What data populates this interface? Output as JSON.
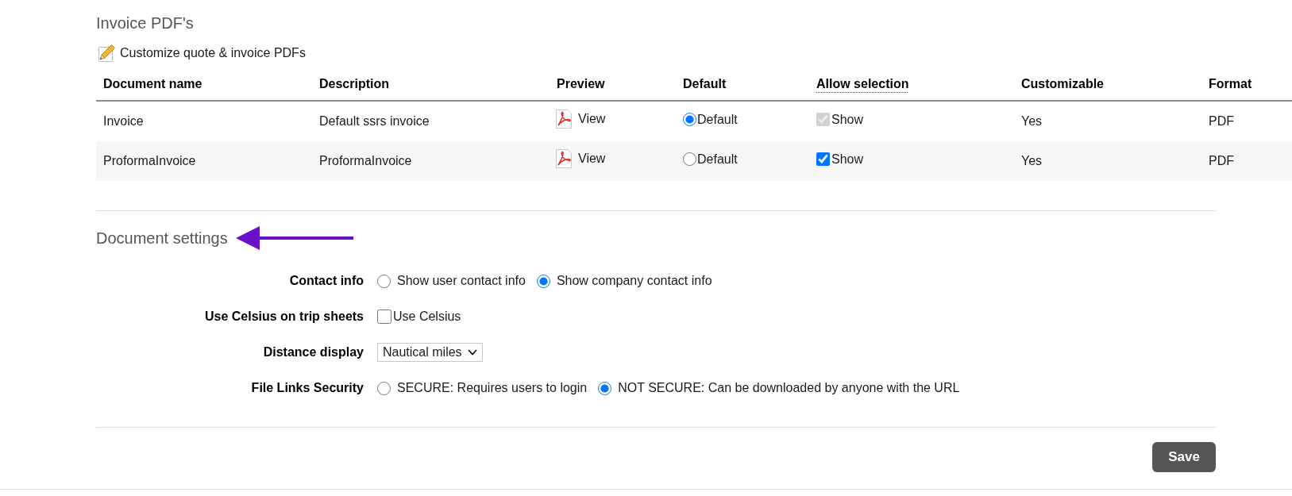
{
  "invoice_pdfs": {
    "title": "Invoice PDF's",
    "customize_link": "Customize quote & invoice PDFs",
    "table": {
      "columns": [
        {
          "label": "Document name",
          "tooltip": false
        },
        {
          "label": "Description",
          "tooltip": false
        },
        {
          "label": "Preview",
          "tooltip": false
        },
        {
          "label": "Default",
          "tooltip": false
        },
        {
          "label": "Allow selection",
          "tooltip": true
        },
        {
          "label": "Customizable",
          "tooltip": false
        },
        {
          "label": "Format",
          "tooltip": false
        }
      ],
      "rows": [
        {
          "document_name": "Invoice",
          "description": "Default ssrs invoice",
          "preview": "View",
          "default": {
            "label": "Default",
            "selected": true
          },
          "allow_selection": {
            "label": "Show",
            "checked": true,
            "disabled": true
          },
          "customizable": "Yes",
          "format": "PDF"
        },
        {
          "document_name": "ProformaInvoice",
          "description": "ProformaInvoice",
          "preview": "View",
          "default": {
            "label": "Default",
            "selected": false
          },
          "allow_selection": {
            "label": "Show",
            "checked": true,
            "disabled": false
          },
          "customizable": "Yes",
          "format": "PDF"
        }
      ]
    }
  },
  "document_settings": {
    "title": "Document settings",
    "settings": [
      {
        "kind": "radio",
        "label": "Contact info",
        "options": [
          {
            "label": "Show user contact info",
            "selected": false
          },
          {
            "label": "Show company contact info",
            "selected": true
          }
        ]
      },
      {
        "kind": "checkbox",
        "label": "Use Celsius on trip sheets",
        "option": {
          "label": "Use Celsius",
          "checked": false
        }
      },
      {
        "kind": "select",
        "label": "Distance display",
        "value": "Nautical miles"
      },
      {
        "kind": "radio",
        "label": "File Links Security",
        "options": [
          {
            "label": "SECURE: Requires users to login",
            "selected": false
          },
          {
            "label": "NOT SECURE: Can be downloaded by anyone with the URL",
            "selected": true
          }
        ]
      }
    ]
  },
  "save_button": "Save"
}
